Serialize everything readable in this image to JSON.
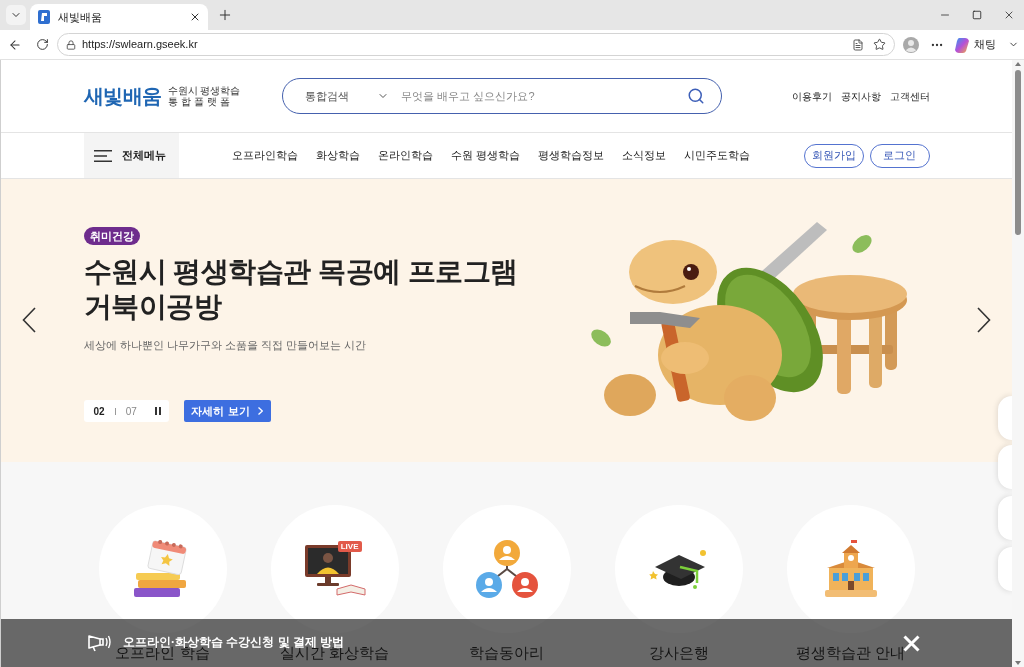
{
  "browser": {
    "tab": {
      "title": "새빛배움"
    },
    "url": "https://swlearn.gseek.kr",
    "chat_button": "채팅"
  },
  "header": {
    "logo": {
      "wordmark": "새빛배움",
      "tagline": [
        "수원시 평생학습",
        "통합플랫폼"
      ]
    },
    "search": {
      "scope": "통합검색",
      "placeholder": "무엇을 배우고 싶으신가요?"
    },
    "links": [
      "이용후기",
      "공지사항",
      "고객센터"
    ]
  },
  "nav": {
    "menu_button": "전체메뉴",
    "items": [
      "오프라인학습",
      "화상학습",
      "온라인학습",
      "수원 평생학습",
      "평생학습정보",
      "소식정보",
      "시민주도학습"
    ],
    "buttons": [
      "회원가입",
      "로그인"
    ]
  },
  "hero": {
    "badge": "취미건강",
    "title": [
      "수원시 평생학습관 목공예 프로그램",
      "거북이공방"
    ],
    "subtitle": "세상에 하나뿐인 나무가구와 소품을 직접 만들어보는 시간",
    "slide": {
      "current": "02",
      "total": "07",
      "playing": true
    },
    "detail_button": "자세히 보기"
  },
  "categories": [
    {
      "kind": "calendar",
      "label": "오프라인 학습"
    },
    {
      "kind": "live",
      "label": "실시간 화상학습",
      "badge": "LIVE"
    },
    {
      "kind": "club",
      "label": "학습동아리"
    },
    {
      "kind": "instructor",
      "label": "강사은행"
    },
    {
      "kind": "building",
      "label": "평생학습관 안내"
    }
  ],
  "notice": {
    "text": "오프라인·화상학습 수강신청 및 결제 방법"
  }
}
